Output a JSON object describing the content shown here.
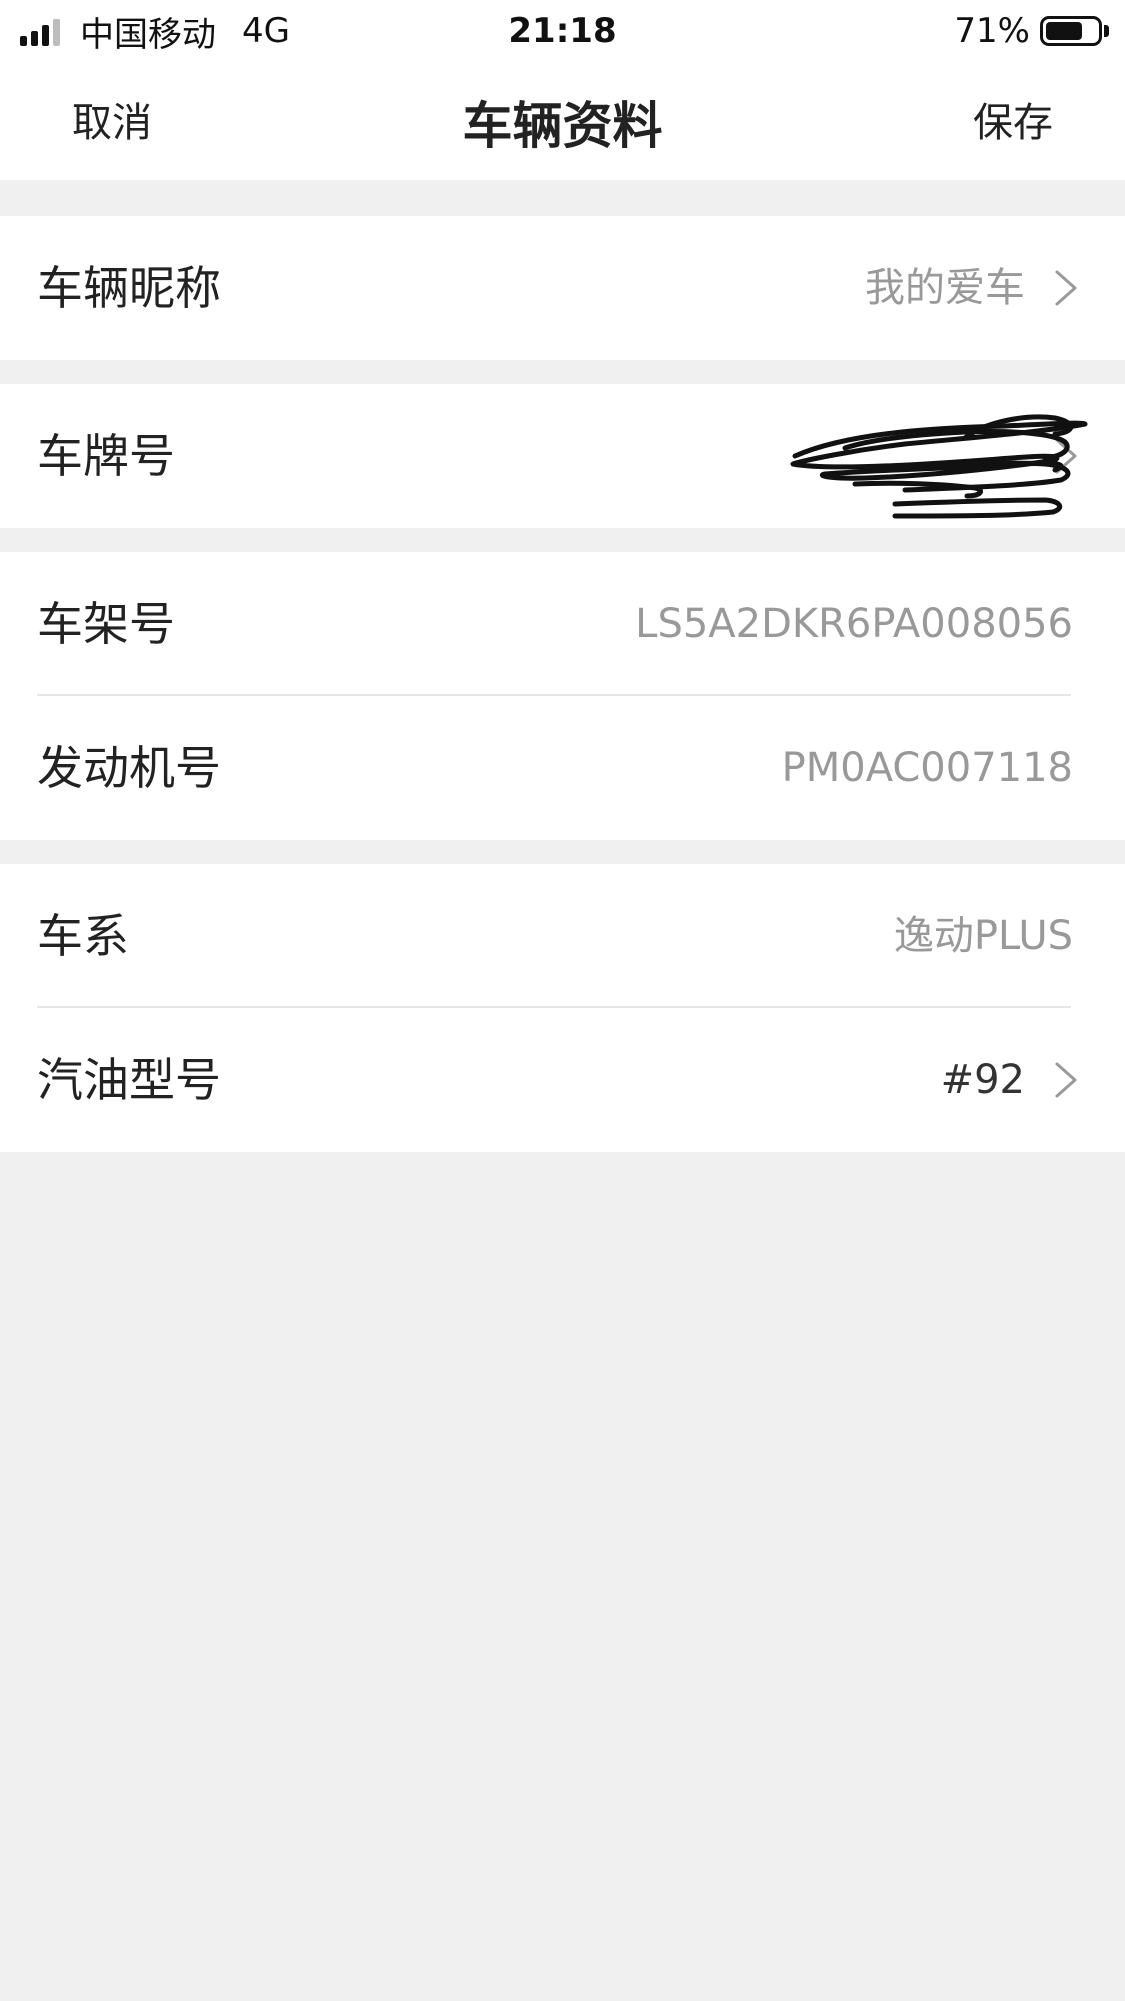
{
  "status_bar": {
    "carrier": "中国移动",
    "network": "4G",
    "time": "21:18",
    "battery": "71%",
    "battery_level": 0.71
  },
  "nav": {
    "cancel": "取消",
    "title": "车辆资料",
    "save": "保存"
  },
  "rows": {
    "nickname": {
      "label": "车辆昵称",
      "value": "我的爱车"
    },
    "plate": {
      "label": "车牌号",
      "value": ""
    },
    "vin": {
      "label": "车架号",
      "value": "LS5A2DKR6PA008056"
    },
    "engine": {
      "label": "发动机号",
      "value": "PM0AC007118"
    },
    "series": {
      "label": "车系",
      "value": "逸动PLUS"
    },
    "fuel": {
      "label": "汽油型号",
      "value": "#92"
    }
  },
  "icons": {
    "chevron": "chevron-right-icon",
    "signal": "signal-bars-icon",
    "battery": "battery-icon"
  }
}
